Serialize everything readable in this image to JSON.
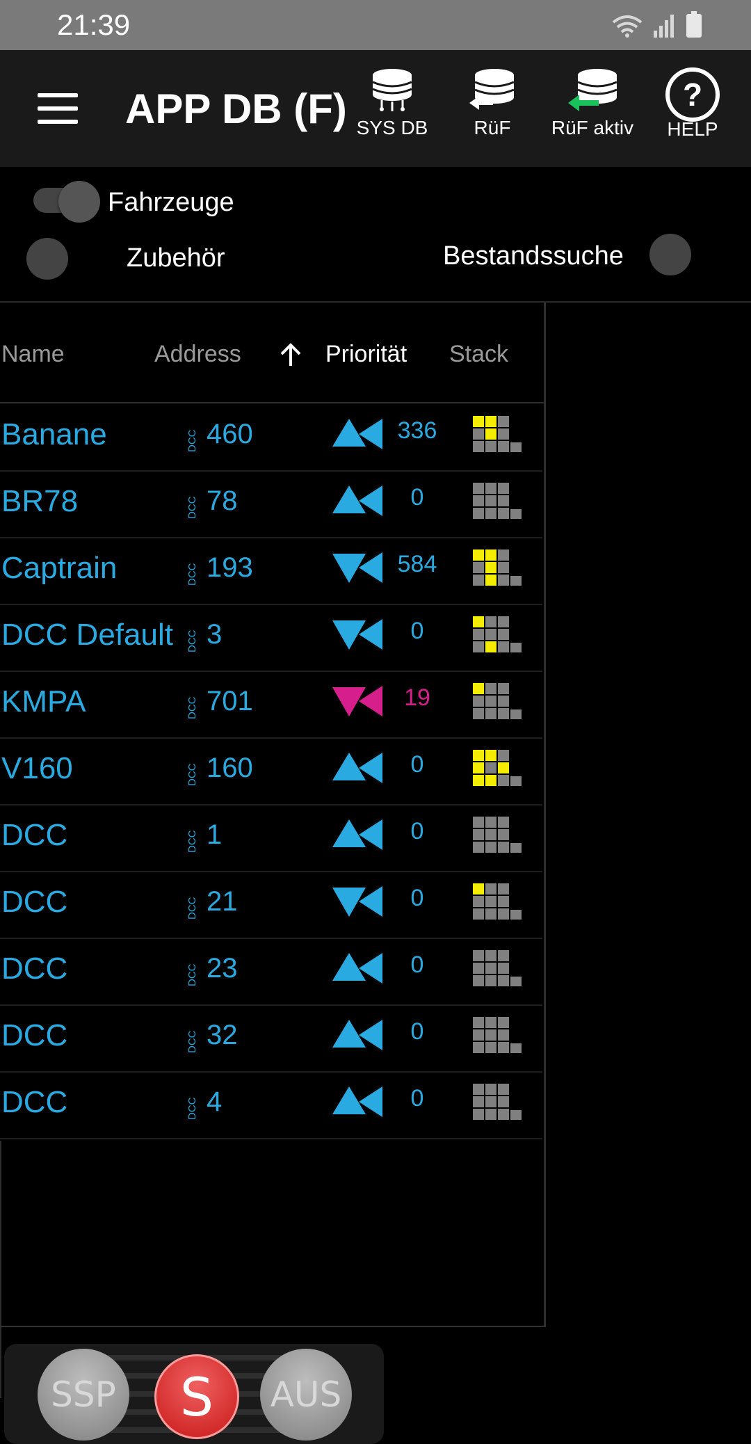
{
  "status_bar": {
    "time": "21:39",
    "icons": [
      "wifi-icon",
      "signal-icon",
      "battery-icon"
    ]
  },
  "app_bar": {
    "title": "APP DB (F)",
    "buttons": [
      {
        "label": "SYS DB",
        "icon": "database-chip-icon"
      },
      {
        "label": "RüF",
        "icon": "database-arrow-icon"
      },
      {
        "label": "RüF aktiv",
        "icon": "database-arrow-green-icon"
      },
      {
        "label": "HELP",
        "icon": "help-circle-icon"
      }
    ]
  },
  "filters": {
    "fahrzeuge": {
      "label": "Fahrzeuge",
      "checked": true
    },
    "zubehoer": {
      "label": "Zubehör",
      "checked": false
    },
    "bestandssuche": {
      "label": "Bestandssuche",
      "checked": false
    }
  },
  "table": {
    "headers": {
      "name": "Name",
      "address": "Address",
      "sort_icon": "arrow-up-icon",
      "priority": "Priorität",
      "stack": "Stack"
    },
    "rows": [
      {
        "name": "Banane",
        "protocol": "DCC",
        "address": "460",
        "direction": "up",
        "priority": "336",
        "color": "#29abe2",
        "stack": [
          1,
          1,
          0,
          0,
          1,
          0,
          0,
          0,
          0,
          0
        ]
      },
      {
        "name": "BR78",
        "protocol": "DCC",
        "address": "78",
        "direction": "up",
        "priority": "0",
        "color": "#29abe2",
        "stack": [
          0,
          0,
          0,
          0,
          0,
          0,
          0,
          0,
          0,
          0
        ]
      },
      {
        "name": "Captrain",
        "protocol": "DCC",
        "address": "193",
        "direction": "down",
        "priority": "584",
        "color": "#29abe2",
        "stack": [
          1,
          1,
          0,
          0,
          1,
          0,
          0,
          1,
          0,
          0
        ]
      },
      {
        "name": "DCC Default",
        "protocol": "DCC",
        "address": "3",
        "direction": "down",
        "priority": "0",
        "color": "#29abe2",
        "stack": [
          1,
          0,
          0,
          0,
          0,
          0,
          0,
          1,
          0,
          0
        ]
      },
      {
        "name": "KMPA",
        "protocol": "DCC",
        "address": "701",
        "direction": "down",
        "priority": "19",
        "color": "#d61f8c",
        "stack": [
          1,
          0,
          0,
          0,
          0,
          0,
          0,
          0,
          0,
          0
        ]
      },
      {
        "name": "V160",
        "protocol": "DCC",
        "address": "160",
        "direction": "up",
        "priority": "0",
        "color": "#29abe2",
        "stack": [
          1,
          1,
          0,
          1,
          0,
          1,
          1,
          1,
          0,
          0
        ]
      },
      {
        "name": "DCC",
        "protocol": "DCC",
        "address": "1",
        "direction": "up",
        "priority": "0",
        "color": "#29abe2",
        "stack": [
          0,
          0,
          0,
          0,
          0,
          0,
          0,
          0,
          0,
          0
        ]
      },
      {
        "name": "DCC",
        "protocol": "DCC",
        "address": "21",
        "direction": "down",
        "priority": "0",
        "color": "#29abe2",
        "stack": [
          1,
          0,
          0,
          0,
          0,
          0,
          0,
          0,
          0,
          0
        ]
      },
      {
        "name": "DCC",
        "protocol": "DCC",
        "address": "23",
        "direction": "up",
        "priority": "0",
        "color": "#29abe2",
        "stack": [
          0,
          0,
          0,
          0,
          0,
          0,
          0,
          0,
          0,
          0
        ]
      },
      {
        "name": "DCC",
        "protocol": "DCC",
        "address": "32",
        "direction": "up",
        "priority": "0",
        "color": "#29abe2",
        "stack": [
          0,
          0,
          0,
          0,
          0,
          0,
          0,
          0,
          0,
          0
        ]
      },
      {
        "name": "DCC",
        "protocol": "DCC",
        "address": "4",
        "direction": "up",
        "priority": "0",
        "color": "#29abe2",
        "stack": [
          0,
          0,
          0,
          0,
          0,
          0,
          0,
          0,
          0,
          0
        ]
      }
    ]
  },
  "bottom_controls": {
    "ssp": "SSP",
    "stop": "S",
    "aus": "AUS"
  },
  "colors": {
    "accent": "#29abe2",
    "highlight": "#d61f8c",
    "stack_on": "#f5ed00",
    "stack_off": "#808080"
  }
}
